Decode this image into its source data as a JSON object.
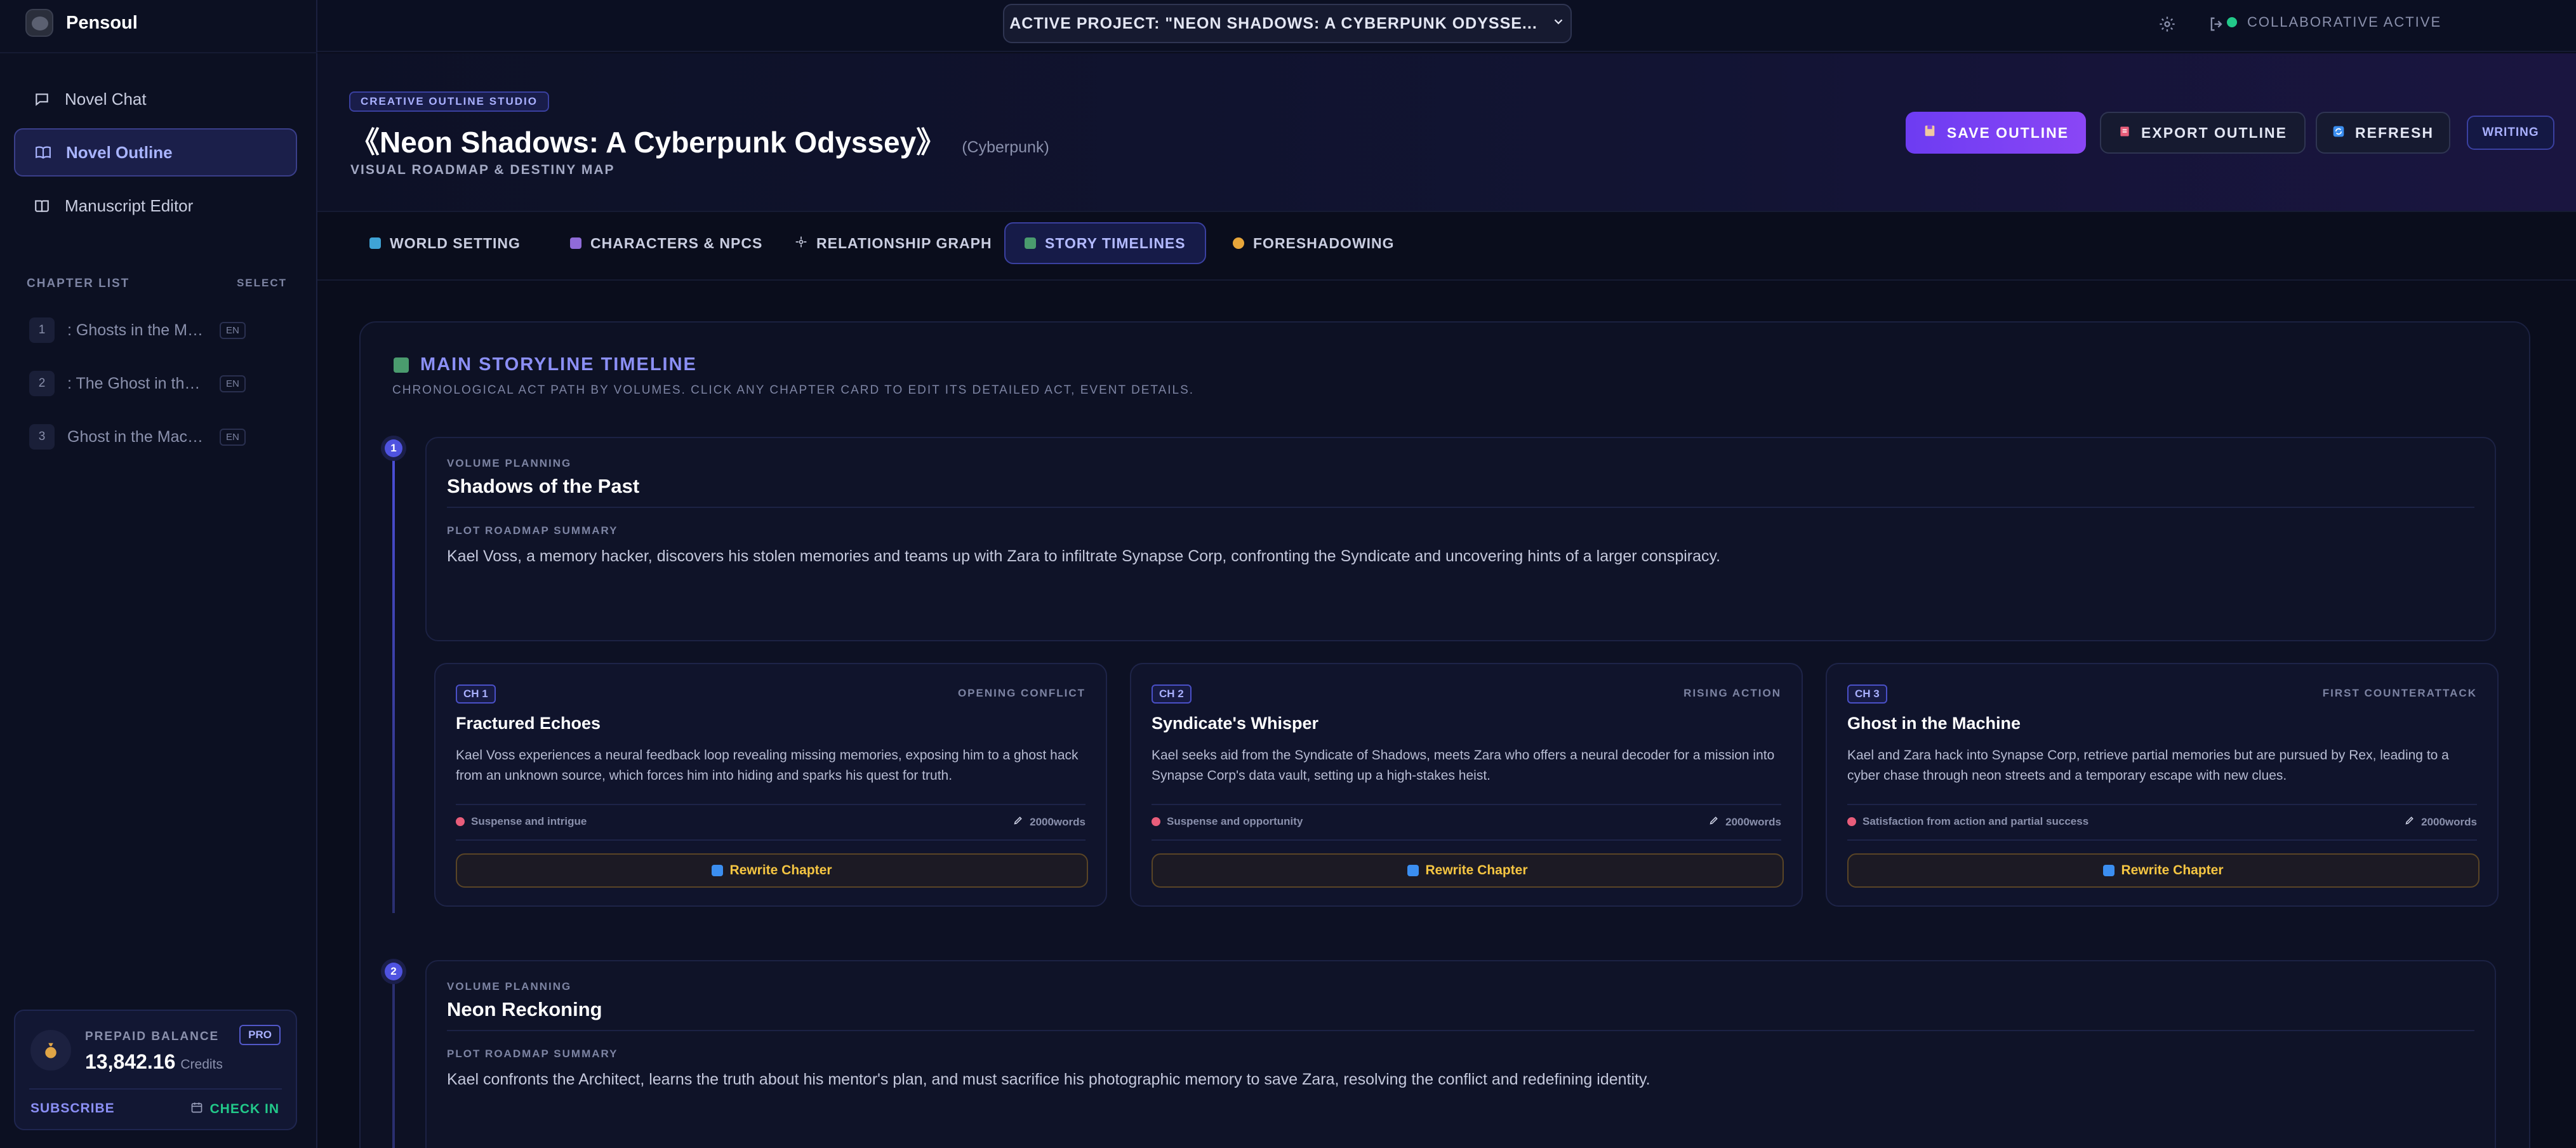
{
  "app": {
    "name": "Pensoul"
  },
  "sidebar": {
    "nav": [
      {
        "label": "Novel Chat",
        "icon": "chat-bubble-icon"
      },
      {
        "label": "Novel Outline",
        "icon": "book-open-icon"
      },
      {
        "label": "Manuscript Editor",
        "icon": "book-icon"
      }
    ],
    "chapters_title": "CHAPTER LIST",
    "chapters_select": "SELECT",
    "chapters": [
      {
        "num": "1",
        "title": ": Ghosts in the Memory Banks",
        "lang": "EN"
      },
      {
        "num": "2",
        "title": ": The Ghost in the Syndicate",
        "lang": "EN"
      },
      {
        "num": "3",
        "title": "Ghost in the Machine",
        "lang": "EN"
      }
    ],
    "balance": {
      "label": "PREPAID BALANCE",
      "value": "13,842.16",
      "unit": "Credits",
      "badge": "PRO",
      "subscribe": "SUBSCRIBE",
      "checkin": "CHECK IN"
    }
  },
  "topbar": {
    "project": "ACTIVE PROJECT: \"NEON SHADOWS: A CYBERPUNK ODYSSE...",
    "collab": "COLLABORATIVE ACTIVE"
  },
  "header": {
    "badge": "CREATIVE OUTLINE STUDIO",
    "title": "《Neon Shadows: A Cyberpunk Odyssey》",
    "genre": "(Cyberpunk)",
    "subtitle": "VISUAL ROADMAP & DESTINY MAP",
    "save": "SAVE OUTLINE",
    "export": "EXPORT OUTLINE",
    "refresh": "REFRESH",
    "mode": "WRITING"
  },
  "tabs": [
    {
      "label": "WORLD SETTING"
    },
    {
      "label": "CHARACTERS & NPCS"
    },
    {
      "label": "RELATIONSHIP GRAPH"
    },
    {
      "label": "STORY TIMELINES"
    },
    {
      "label": "FORESHADOWING"
    }
  ],
  "timeline": {
    "title": "MAIN STORYLINE TIMELINE",
    "desc": "CHRONOLOGICAL ACT PATH BY VOLUMES. CLICK ANY CHAPTER CARD TO EDIT ITS DETAILED ACT, EVENT DETAILS.",
    "volumes": [
      {
        "num": "1",
        "label": "VOLUME PLANNING",
        "title": "Shadows of the Past",
        "summary_label": "PLOT ROADMAP SUMMARY",
        "summary": "Kael Voss, a memory hacker, discovers his stolen memories and teams up with Zara to infiltrate Synapse Corp, confronting the Syndicate and uncovering hints of a larger conspiracy.",
        "chapters": [
          {
            "badge": "CH 1",
            "stage": "OPENING CONFLICT",
            "title": "Fractured Echoes",
            "desc": "Kael Voss experiences a neural feedback loop revealing missing memories, exposing him to a ghost hack from an unknown source, which forces him into hiding and sparks his quest for truth.",
            "emotion": "Suspense and intrigue",
            "words": "2000words",
            "rewrite": "Rewrite Chapter"
          },
          {
            "badge": "CH 2",
            "stage": "RISING ACTION",
            "title": "Syndicate's Whisper",
            "desc": "Kael seeks aid from the Syndicate of Shadows, meets Zara who offers a neural decoder for a mission into Synapse Corp's data vault, setting up a high-stakes heist.",
            "emotion": "Suspense and opportunity",
            "words": "2000words",
            "rewrite": "Rewrite Chapter"
          },
          {
            "badge": "CH 3",
            "stage": "FIRST COUNTERATTACK",
            "title": "Ghost in the Machine",
            "desc": "Kael and Zara hack into Synapse Corp, retrieve partial memories but are pursued by Rex, leading to a cyber chase through neon streets and a temporary escape with new clues.",
            "emotion": "Satisfaction from action and partial success",
            "words": "2000words",
            "rewrite": "Rewrite Chapter"
          }
        ]
      },
      {
        "num": "2",
        "label": "VOLUME PLANNING",
        "title": "Neon Reckoning",
        "summary_label": "PLOT ROADMAP SUMMARY",
        "summary": "Kael confronts the Architect, learns the truth about his mentor's plan, and must sacrifice his photographic memory to save Zara, resolving the conflict and redefining identity."
      }
    ]
  }
}
